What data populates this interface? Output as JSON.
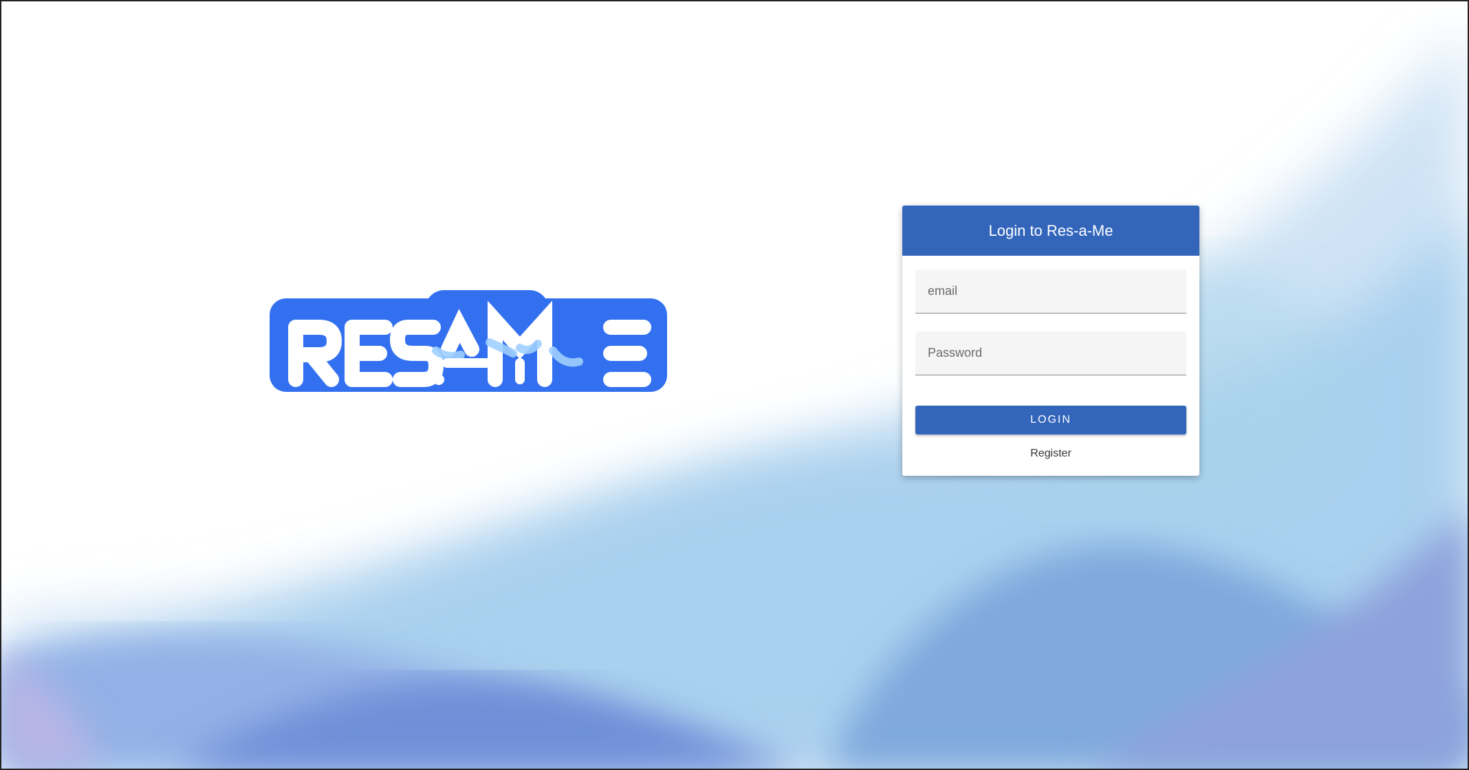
{
  "brand": {
    "logo_text": "RES-A-ME",
    "primary_color": "#3366bb",
    "logo_color": "#3370f0"
  },
  "login": {
    "title": "Login to Res-a-Me",
    "email_placeholder": "email",
    "password_placeholder": "Password",
    "login_label": "LOGIN",
    "register_label": "Register"
  }
}
